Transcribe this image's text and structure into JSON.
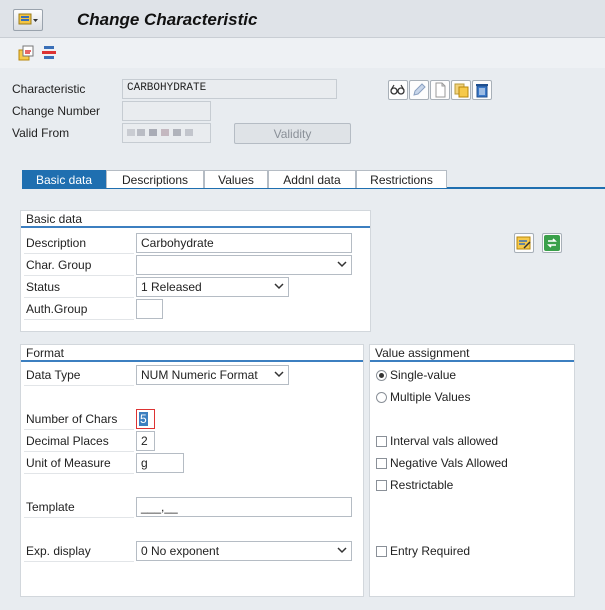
{
  "window": {
    "title": "Change Characteristic"
  },
  "header": {
    "characteristic_label": "Characteristic",
    "characteristic_value": "CARBOHYDRATE",
    "change_number_label": "Change Number",
    "change_number_value": "",
    "valid_from_label": "Valid From",
    "validity_button": "Validity"
  },
  "tabs": [
    {
      "label": "Basic data",
      "active": true
    },
    {
      "label": "Descriptions",
      "active": false
    },
    {
      "label": "Values",
      "active": false
    },
    {
      "label": "Addnl data",
      "active": false
    },
    {
      "label": "Restrictions",
      "active": false
    }
  ],
  "basic_data": {
    "title": "Basic data",
    "description_label": "Description",
    "description_value": "Carbohydrate",
    "char_group_label": "Char. Group",
    "char_group_value": "",
    "status_label": "Status",
    "status_value": "1 Released",
    "auth_group_label": "Auth.Group",
    "auth_group_value": ""
  },
  "format": {
    "title": "Format",
    "data_type_label": "Data Type",
    "data_type_value": "NUM Numeric Format",
    "num_chars_label": "Number of Chars",
    "num_chars_value": "5",
    "decimal_places_label": "Decimal Places",
    "decimal_places_value": "2",
    "unit_label": "Unit of Measure",
    "unit_value": "g",
    "template_label": "Template",
    "template_value": "___,__",
    "exp_display_label": "Exp. display",
    "exp_display_value": "0 No exponent"
  },
  "value_assignment": {
    "title": "Value assignment",
    "single_value": "Single-value",
    "multiple_values": "Multiple Values",
    "selected": "single",
    "interval_vals": "Interval vals allowed",
    "negative_vals": "Negative Vals Allowed",
    "restrictable": "Restrictable",
    "entry_required": "Entry Required"
  },
  "colors": {
    "accent": "#1f6fb0",
    "background": "#e8ecf0"
  }
}
